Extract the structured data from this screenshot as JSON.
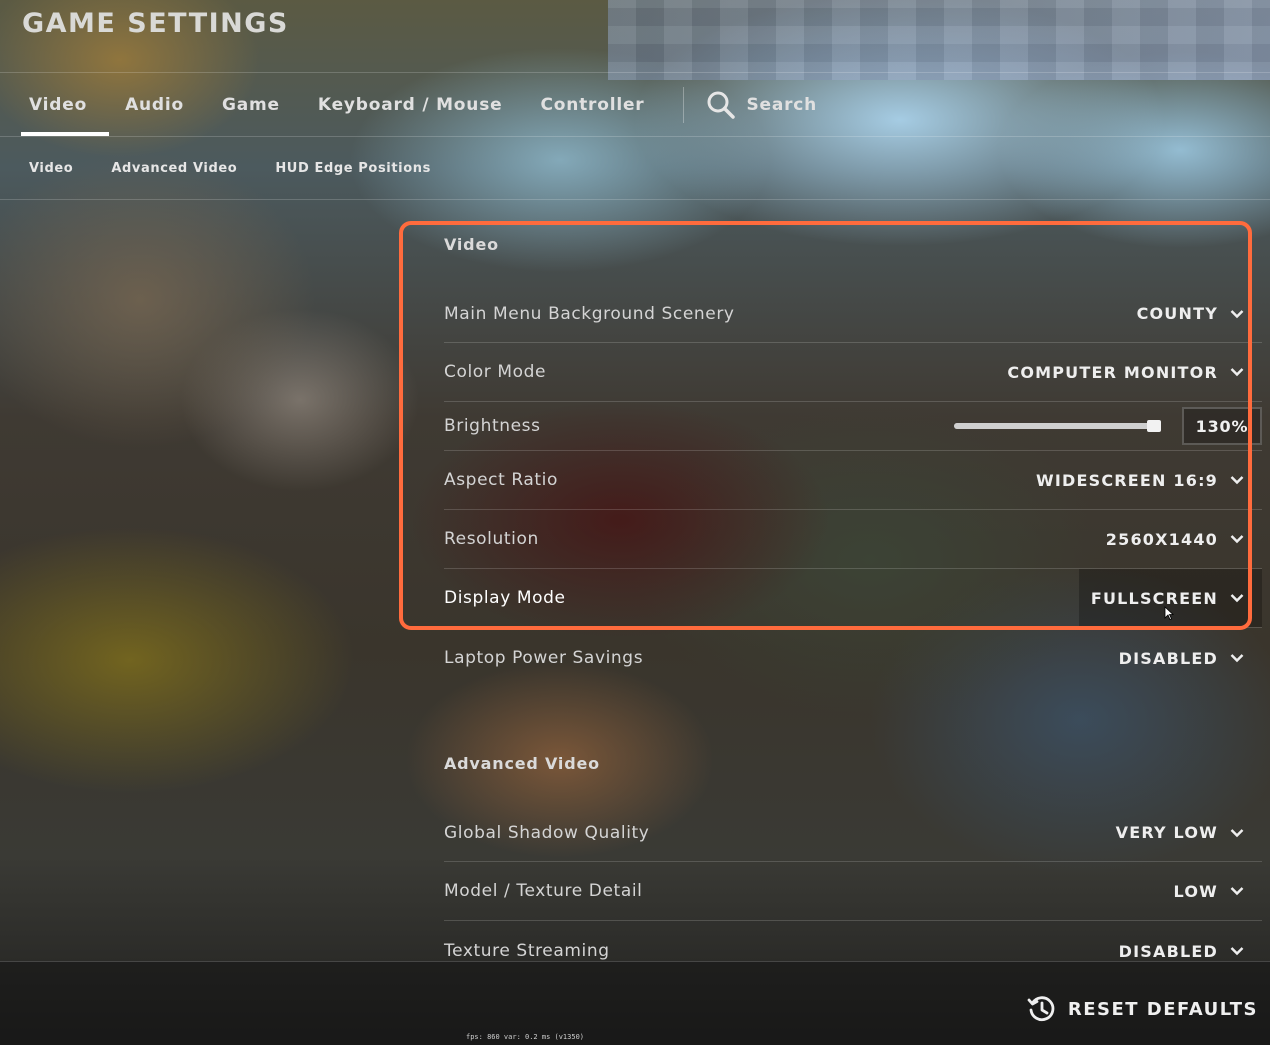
{
  "header": {
    "title": "GAME SETTINGS"
  },
  "tabs": [
    {
      "label": "Video",
      "active": true
    },
    {
      "label": "Audio"
    },
    {
      "label": "Game"
    },
    {
      "label": "Keyboard / Mouse"
    },
    {
      "label": "Controller"
    }
  ],
  "search": {
    "label": "Search",
    "icon": "search-icon"
  },
  "subtabs": [
    {
      "label": "Video"
    },
    {
      "label": "Advanced Video"
    },
    {
      "label": "HUD Edge Positions"
    }
  ],
  "video_section": {
    "title": "Video",
    "main_menu_background": {
      "label": "Main Menu Background Scenery",
      "value": "COUNTY"
    },
    "color_mode": {
      "label": "Color Mode",
      "value": "COMPUTER MONITOR"
    },
    "brightness": {
      "label": "Brightness",
      "value": "130%",
      "slider_fraction": 0.97
    },
    "aspect_ratio": {
      "label": "Aspect Ratio",
      "value": "WIDESCREEN 16:9"
    },
    "resolution": {
      "label": "Resolution",
      "value": "2560X1440"
    },
    "display_mode": {
      "label": "Display Mode",
      "value": "FULLSCREEN"
    },
    "laptop_power": {
      "label": "Laptop Power Savings",
      "value": "DISABLED"
    }
  },
  "advanced_section": {
    "title": "Advanced Video",
    "shadow_quality": {
      "label": "Global Shadow Quality",
      "value": "VERY LOW"
    },
    "texture_detail": {
      "label": "Model / Texture Detail",
      "value": "LOW"
    },
    "texture_streaming": {
      "label": "Texture Streaming",
      "value": "DISABLED"
    }
  },
  "footer": {
    "reset_label": "RESET DEFAULTS",
    "fps_readout": "fps:   860  var:  0.2 ms (v1350)"
  },
  "colors": {
    "highlight": "#ff6b3d",
    "tab_underline": "#ffffff"
  }
}
